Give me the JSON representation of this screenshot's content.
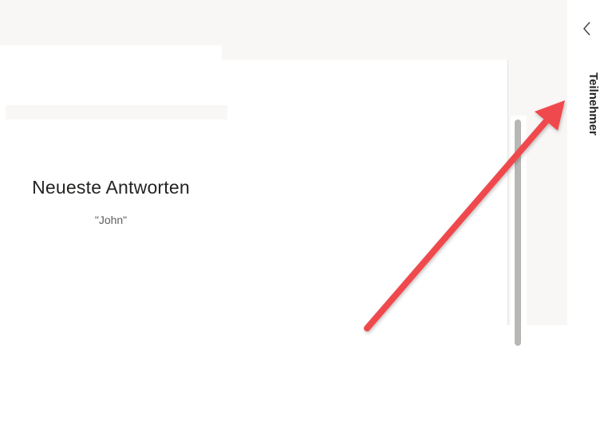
{
  "sidebar": {
    "title": "Teilnehmer",
    "collapse_icon": "chevron-left-icon"
  },
  "main": {
    "heading": "Neueste Antworten",
    "latest_response": "\"John\""
  },
  "annotation": {
    "arrow_color": "#f0484e"
  }
}
